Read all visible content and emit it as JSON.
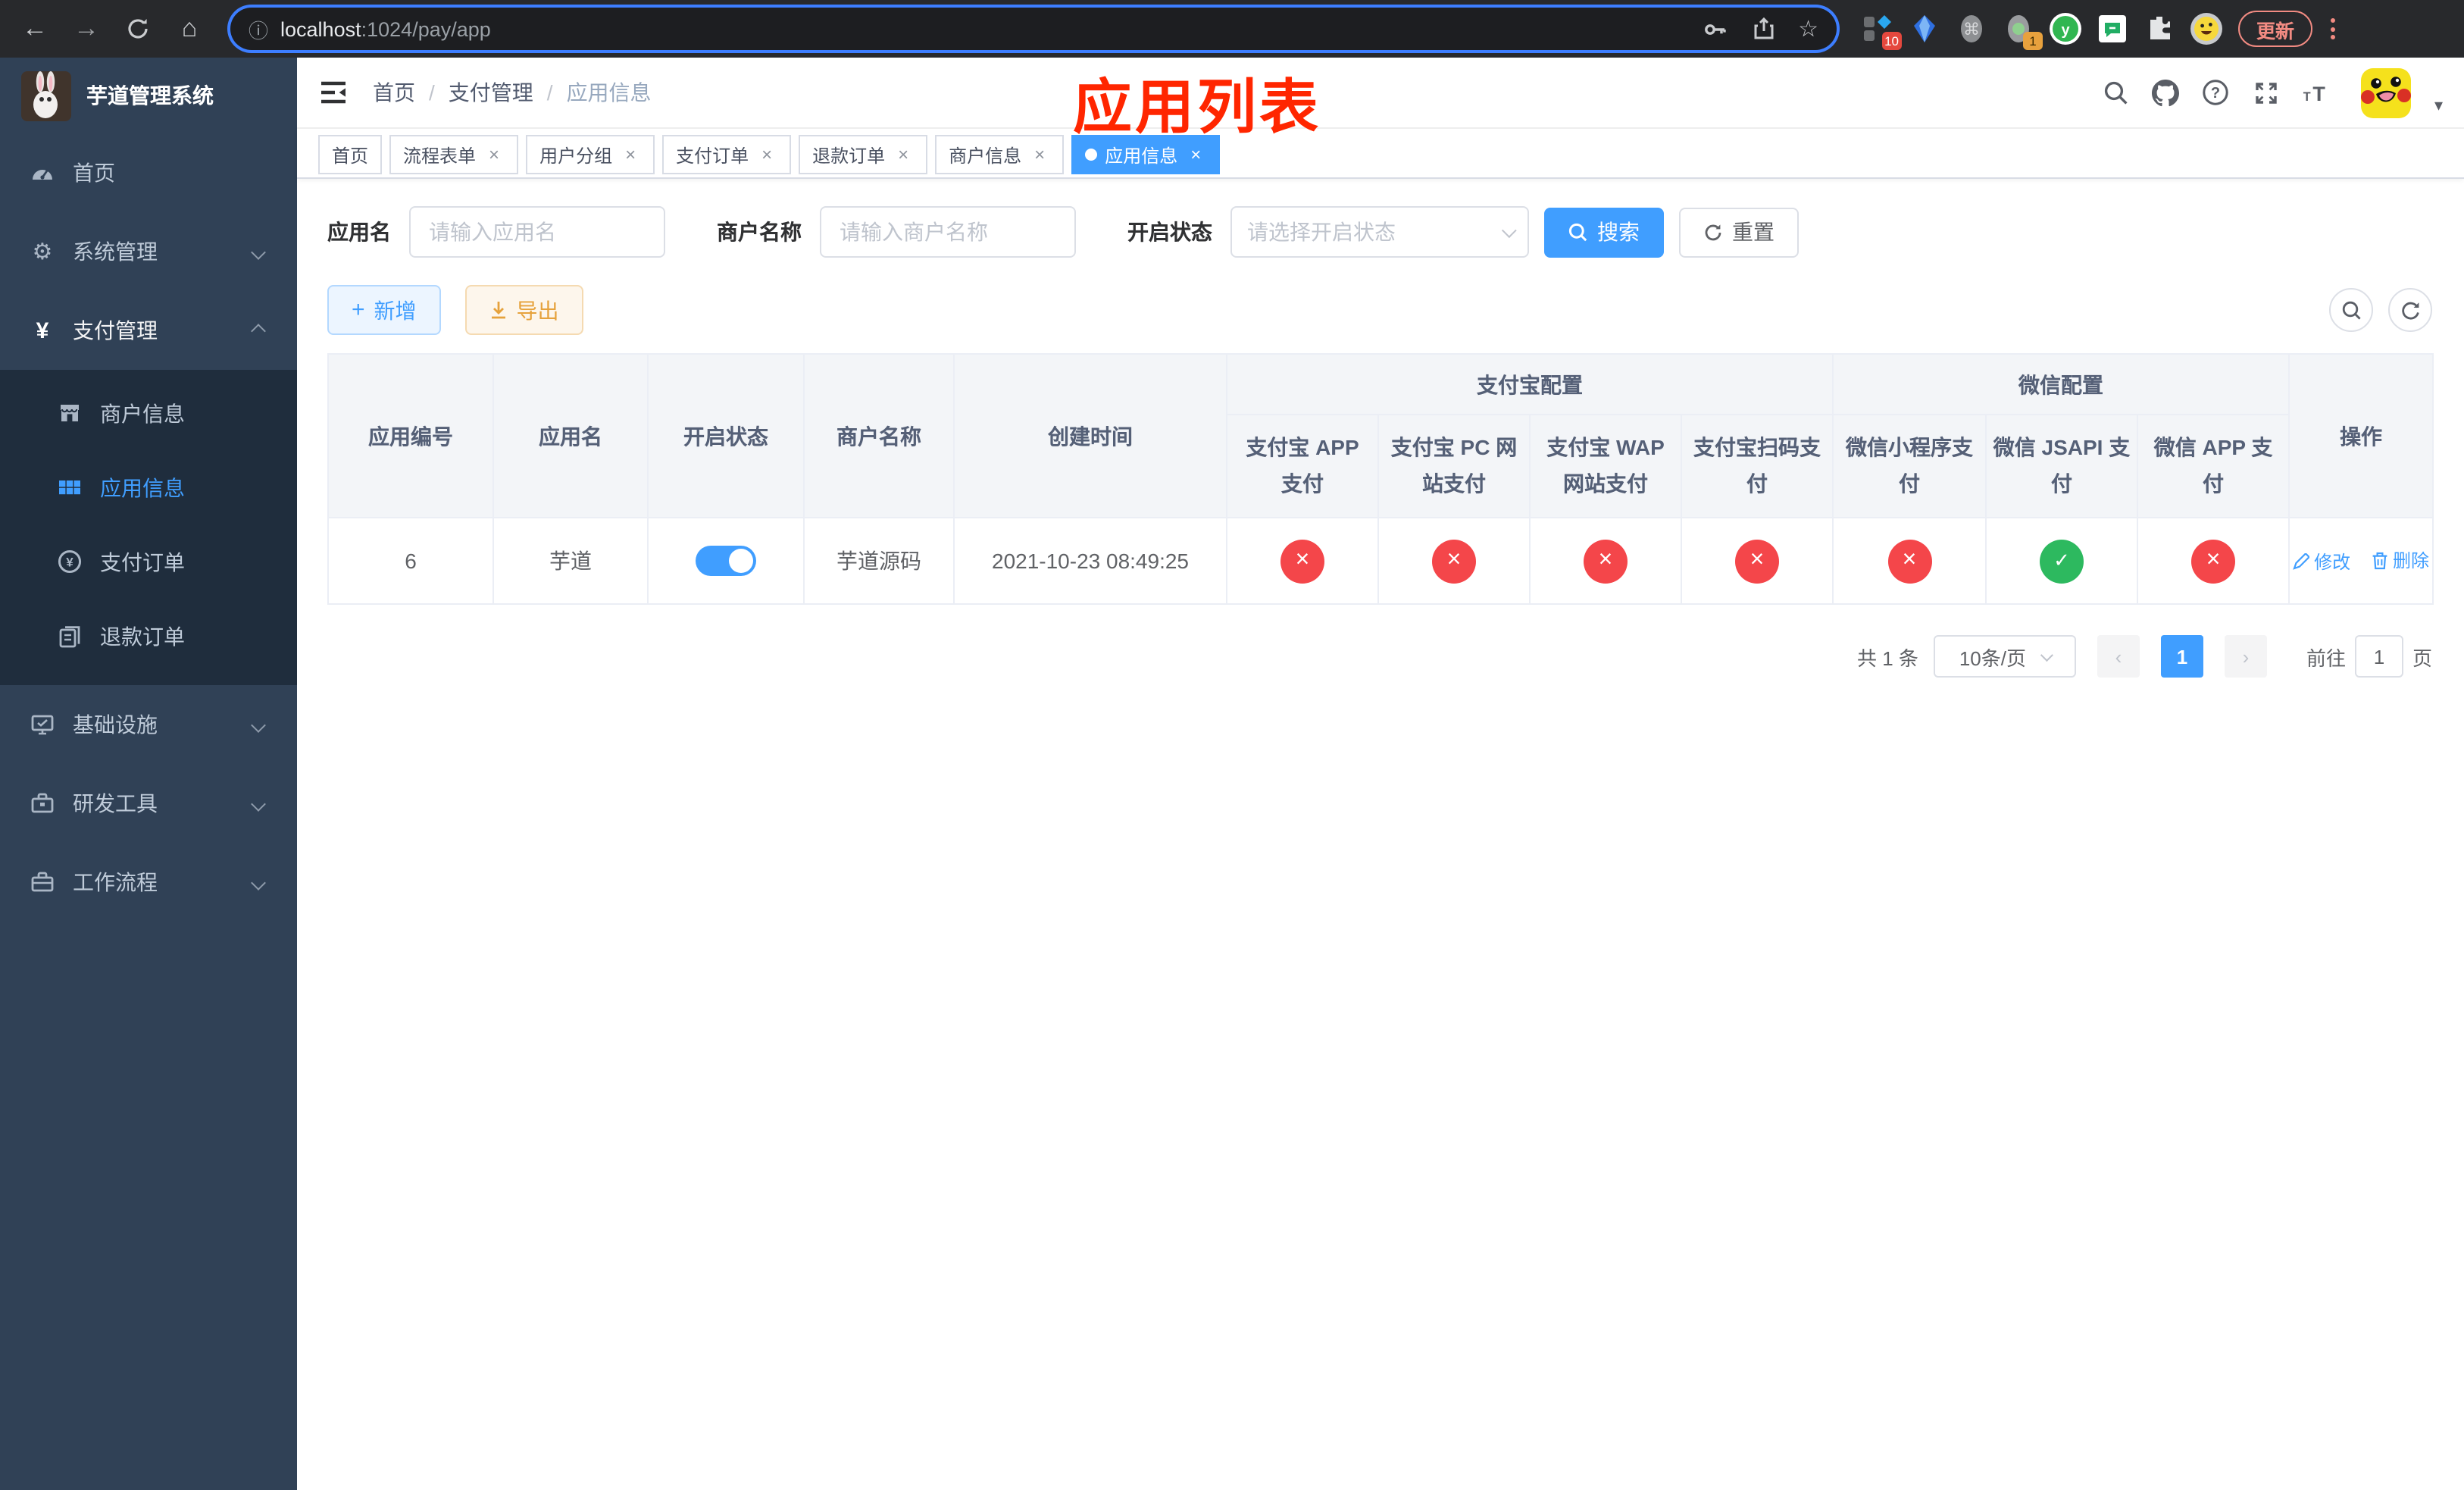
{
  "browser": {
    "url": {
      "host": "localhost",
      "rest": ":1024/pay/app"
    },
    "update_label": "更新",
    "ext_badge_collection": "10",
    "ext_badge_recorder": "1",
    "icons": {
      "back": "←",
      "forward": "→",
      "home": "⌂",
      "info": "ⓘ",
      "bookmark": "☆",
      "command": "⌘",
      "vue_ext": "y"
    }
  },
  "sidebar": {
    "title": "芋道管理系统",
    "home": "首页",
    "system": "系统管理",
    "payment": "支付管理",
    "payment_children": {
      "merchant": "商户信息",
      "app": "应用信息",
      "order": "支付订单",
      "refund": "退款订单"
    },
    "infra": "基础设施",
    "devtool": "研发工具",
    "workflow": "工作流程"
  },
  "navbar": {
    "breadcrumb": {
      "home": "首页",
      "payment": "支付管理",
      "app": "应用信息"
    },
    "overlay_title": "应用列表"
  },
  "tabs": {
    "home": "首页",
    "flow_form": "流程表单",
    "user_group": "用户分组",
    "pay_order": "支付订单",
    "refund_order": "退款订单",
    "merchant_info": "商户信息",
    "app_info": "应用信息"
  },
  "filters": {
    "app_name_label": "应用名",
    "app_name_placeholder": "请输入应用名",
    "merchant_label": "商户名称",
    "merchant_placeholder": "请输入商户名称",
    "status_label": "开启状态",
    "status_placeholder": "请选择开启状态",
    "search_label": "搜索",
    "reset_label": "重置"
  },
  "toolbar": {
    "add_label": "新增",
    "export_label": "导出"
  },
  "table": {
    "headers": {
      "app_id": "应用编号",
      "app_name": "应用名",
      "status": "开启状态",
      "merchant": "商户名称",
      "created": "创建时间",
      "alipay_group": "支付宝配置",
      "wechat_group": "微信配置",
      "actions": "操作",
      "alipay_cols": [
        "支付宝 APP 支付",
        "支付宝 PC 网站支付",
        "支付宝 WAP 网站支付",
        "支付宝扫码支付"
      ],
      "wechat_cols": [
        "微信小程序支付",
        "微信 JSAPI 支付",
        "微信 APP 支付"
      ]
    },
    "rows": [
      {
        "id": "6",
        "name": "芋道",
        "enabled": "true",
        "merchant": "芋道源码",
        "created": "2021-10-23 08:49:25",
        "configs": [
          "error",
          "error",
          "error",
          "error",
          "error",
          "success",
          "error"
        ],
        "edit_label": "修改",
        "delete_label": "删除"
      }
    ]
  },
  "pagination": {
    "total": "共 1 条",
    "per_page": "10条/页",
    "page": "1",
    "goto_label": "前往",
    "goto_value": "1",
    "unit_label": "页"
  }
}
